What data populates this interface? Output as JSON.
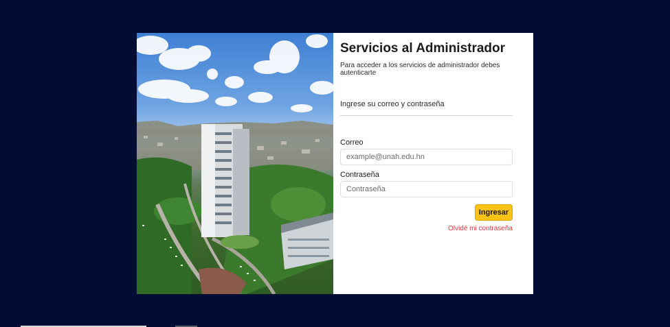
{
  "login": {
    "title": "Servicios al Administrador",
    "subtitle": "Para acceder a los servicios de administrador debes autenticarte",
    "instruction": "Ingrese su correo y contraseña",
    "email_label": "Correo",
    "email_placeholder": "example@unah.edu.hn",
    "password_label": "Contraseña",
    "password_placeholder": "Contraseña",
    "submit_label": "Ingresar",
    "forgot_label": "Olvidé mi contraseña"
  },
  "colors": {
    "page_background": "#020d33",
    "button": "#f8c314",
    "link": "#dc3545"
  }
}
